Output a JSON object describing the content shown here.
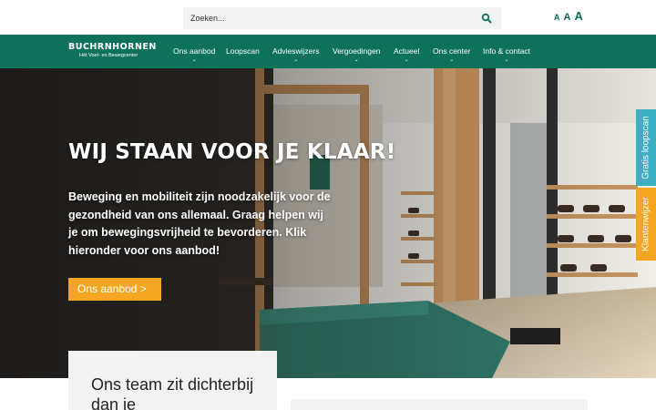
{
  "search": {
    "placeholder": "Zoeken..."
  },
  "font_sizes": [
    "A",
    "A",
    "A"
  ],
  "logo": {
    "name": "BUCHRNHORNEN",
    "tagline": "Hét Voet- en Bewegcenter"
  },
  "nav": {
    "items": [
      {
        "label": "Ons aanbod",
        "has_dropdown": true
      },
      {
        "label": "Loopscan",
        "has_dropdown": false
      },
      {
        "label": "Advieswijzers",
        "has_dropdown": true
      },
      {
        "label": "Vergoedingen",
        "has_dropdown": true
      },
      {
        "label": "Actueel",
        "has_dropdown": true
      },
      {
        "label": "Ons center",
        "has_dropdown": true
      },
      {
        "label": "Info & contact",
        "has_dropdown": true
      }
    ]
  },
  "hero": {
    "title": "WIJ STAAN VOOR JE KLAAR!",
    "text": "Beweging en mobiliteit zijn noodzakelijk voor de gezondheid van ons allemaal. Graag helpen wij je om bewegingsvrijheid te bevorderen. Klik hieronder voor ons aanbod!",
    "button": "Ons aanbod  >"
  },
  "side_tabs": {
    "loopscan": "Gratis loopscan",
    "klantenwijzer": "Klantenwijzer"
  },
  "team": {
    "title": "Ons team zit dichterbij dan je"
  },
  "colors": {
    "brand_green": "#0e7159",
    "accent_orange": "#f4a622",
    "accent_blue": "#3bb0c4"
  }
}
